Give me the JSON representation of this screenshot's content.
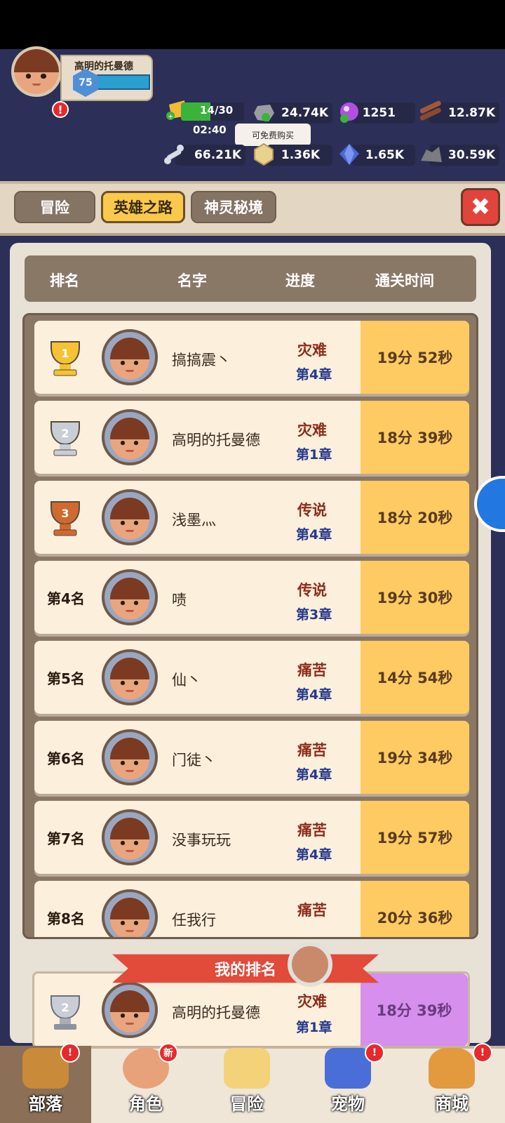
{
  "player": {
    "name": "高明的托曼德",
    "level": "75"
  },
  "energy": {
    "value": "14/30",
    "timer": "02:40",
    "fill": 0.47
  },
  "tooltip": "可免费购买",
  "resources": {
    "ore": "24.74K",
    "gem_purple": "1251",
    "wood": "12.87K",
    "bone": "66.21K",
    "coin": "1.36K",
    "crystal": "1.65K",
    "stone": "30.59K"
  },
  "tabs": [
    {
      "label": "冒险",
      "active": false
    },
    {
      "label": "英雄之路",
      "active": true
    },
    {
      "label": "神灵秘境",
      "active": false
    }
  ],
  "table": {
    "headers": [
      "排名",
      "名字",
      "进度",
      "通关时间"
    ],
    "rows": [
      {
        "rank": "1",
        "rank_type": "gold",
        "name": "搞搞震丶",
        "difficulty": "灾难",
        "chapter": "第4章",
        "time": "19分 52秒"
      },
      {
        "rank": "2",
        "rank_type": "silver",
        "name": "高明的托曼德",
        "difficulty": "灾难",
        "chapter": "第1章",
        "time": "18分 39秒"
      },
      {
        "rank": "3",
        "rank_type": "bronze",
        "name": "浅墨灬",
        "difficulty": "传说",
        "chapter": "第4章",
        "time": "18分 20秒"
      },
      {
        "rank": "第4名",
        "rank_type": "text",
        "name": "啧",
        "difficulty": "传说",
        "chapter": "第3章",
        "time": "19分 30秒"
      },
      {
        "rank": "第5名",
        "rank_type": "text",
        "name": "仙丶",
        "difficulty": "痛苦",
        "chapter": "第4章",
        "time": "14分 54秒"
      },
      {
        "rank": "第6名",
        "rank_type": "text",
        "name": "门徒丶",
        "difficulty": "痛苦",
        "chapter": "第4章",
        "time": "19分 34秒"
      },
      {
        "rank": "第7名",
        "rank_type": "text",
        "name": "没事玩玩",
        "difficulty": "痛苦",
        "chapter": "第4章",
        "time": "19分 57秒"
      },
      {
        "rank": "第8名",
        "rank_type": "text",
        "name": "任我行",
        "difficulty": "痛苦",
        "chapter": "",
        "time": "20分 36秒"
      }
    ]
  },
  "my_rank": {
    "banner": "我的排名",
    "rank": "2",
    "name": "高明的托曼德",
    "difficulty": "灾难",
    "chapter": "第1章",
    "time": "18分 39秒"
  },
  "nav": [
    {
      "label": "部落",
      "badge": "!",
      "active": true
    },
    {
      "label": "角色",
      "badge": "新",
      "active": false
    },
    {
      "label": "冒险",
      "badge": "",
      "active": false
    },
    {
      "label": "宠物",
      "badge": "!",
      "active": false
    },
    {
      "label": "商城",
      "badge": "!",
      "active": false
    }
  ],
  "colors": {
    "gold": "#f5c233",
    "silver": "#c9cdd6",
    "bronze": "#d0692f",
    "time_bg": "#fdcb61",
    "my_time_bg": "#d68fec"
  }
}
